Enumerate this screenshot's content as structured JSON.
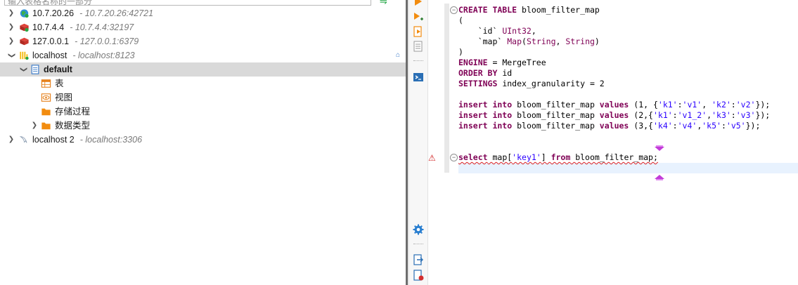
{
  "navigator": {
    "filter_placeholder": "输入表格名称的一部分",
    "connections": [
      {
        "name": "10.7.20.26",
        "desc": "- 10.7.20.26:42721"
      },
      {
        "name": "10.7.4.4",
        "desc": "- 10.7.4.4:32197"
      },
      {
        "name": "127.0.0.1",
        "desc": "- 127.0.0.1:6379"
      },
      {
        "name": "localhost",
        "desc": "- localhost:8123"
      }
    ],
    "database": {
      "name": "default"
    },
    "folders": [
      {
        "label": "表"
      },
      {
        "label": "视图"
      },
      {
        "label": "存储过程"
      },
      {
        "label": "数据类型"
      }
    ],
    "connection5": {
      "name": "localhost 2",
      "desc": "- localhost:3306"
    }
  },
  "colors": {
    "keyword": "#7f0055",
    "string": "#2a00ff",
    "selected_row": "#d9d9d9",
    "current_line": "#e8f2fe",
    "error": "#e02020"
  },
  "editor": {
    "lines": [
      "CREATE TABLE bloom_filter_map",
      "(",
      "    `id` UInt32,",
      "    `map` Map(String, String)",
      ")",
      "ENGINE = MergeTree",
      "ORDER BY id",
      "SETTINGS index_granularity = 2",
      "",
      "insert into bloom_filter_map values (1, {'k1':'v1', 'k2':'v2'});",
      "insert into bloom_filter_map values (2,{'k1':'v1_2','k3':'v3'});",
      "insert into bloom_filter_map values (3,{'k4':'v4','k5':'v5'});",
      "",
      "",
      "select map['key1'] from bloom_filter_map;"
    ]
  }
}
